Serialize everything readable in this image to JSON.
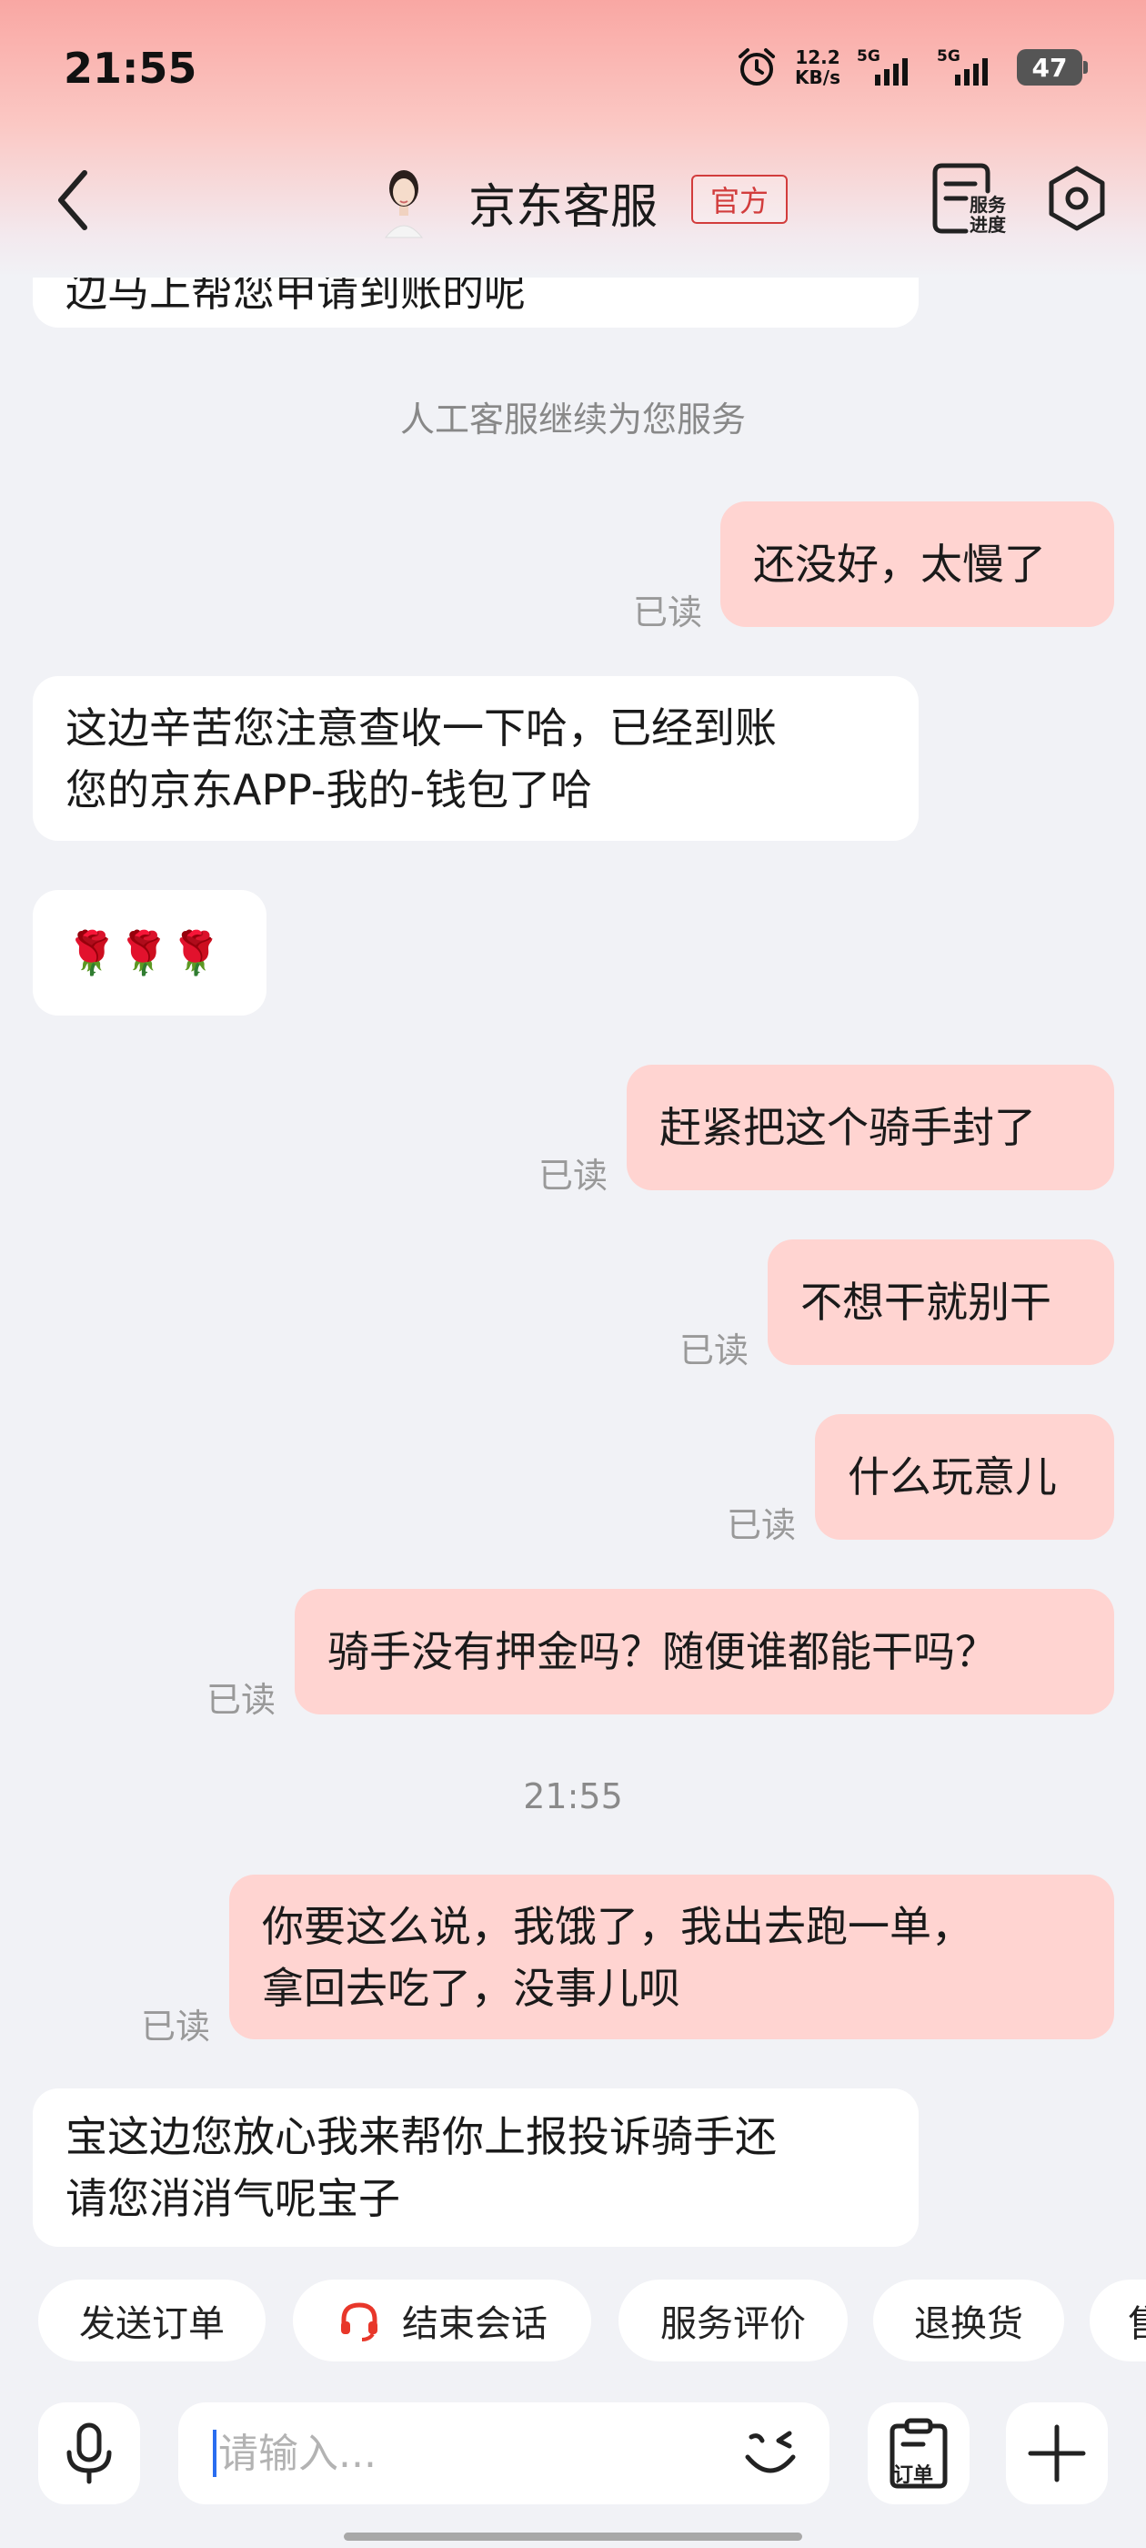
{
  "status_bar": {
    "time": "21:55",
    "net_speed": "12.2",
    "net_unit": "KB/s",
    "sig1_label": "5G",
    "sig2_label": "5G",
    "battery": "47"
  },
  "header": {
    "title": "京东客服",
    "badge": "官方",
    "progress_line1": "服务",
    "progress_line2": "进度"
  },
  "messages": {
    "partial_incoming": "边马上帮您申请到账的呢",
    "system_notice": "人工客服继续为您服务",
    "m1": "还没好，太慢了",
    "m2_line1": "这边辛苦您注意查收一下哈，已经到账",
    "m2_line2": "您的京东APP-我的-钱包了哈",
    "m3": "🌹🌹🌹",
    "m4": "赶紧把这个骑手封了",
    "m5": "不想干就别干",
    "m6": "什么玩意儿",
    "m7": "骑手没有押金吗？随便谁都能干吗？",
    "timestamp": "21:55",
    "m8_line1": "你要这么说，我饿了，我出去跑一单，",
    "m8_line2": "拿回去吃了，没事儿呗",
    "m9_line1": "宝这边您放心我来帮你上报投诉骑手还",
    "m9_line2": "请您消消气呢宝子",
    "read_label": "已读"
  },
  "quick_actions": [
    "发送订单",
    "结束会话",
    "服务评价",
    "退换货",
    "售"
  ],
  "input": {
    "placeholder": "请输入...",
    "order_label": "订单"
  },
  "colors": {
    "outgoing_bubble": "#ffd4d1",
    "incoming_bubble": "#ffffff",
    "background": "#f1f2f6",
    "accent_red": "#d23c3c",
    "caret_blue": "#2a6df0"
  }
}
